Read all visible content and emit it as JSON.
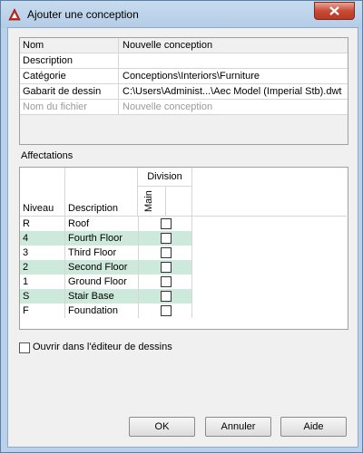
{
  "window": {
    "title": "Ajouter une conception",
    "icon": "autocad-logo-icon"
  },
  "properties": [
    {
      "key": "Nom",
      "value": "Nouvelle conception"
    },
    {
      "key": "Description",
      "value": ""
    },
    {
      "key": "Catégorie",
      "value": "Conceptions\\Interiors\\Furniture"
    },
    {
      "key": "Gabarit de dessin",
      "value": "C:\\Users\\Administ...\\Aec Model (Imperial Stb).dwt"
    },
    {
      "key": "Nom du fichier",
      "value": "Nouvelle conception"
    }
  ],
  "assignments": {
    "label": "Affectations",
    "headers": {
      "level": "Niveau",
      "description": "Description",
      "division": "Division",
      "main": "Main"
    },
    "rows": [
      {
        "level": "R",
        "description": "Roof",
        "checked": false
      },
      {
        "level": "4",
        "description": "Fourth Floor",
        "checked": false
      },
      {
        "level": "3",
        "description": "Third Floor",
        "checked": false
      },
      {
        "level": "2",
        "description": "Second Floor",
        "checked": false
      },
      {
        "level": "1",
        "description": "Ground Floor",
        "checked": false
      },
      {
        "level": "S",
        "description": "Stair Base",
        "checked": false
      },
      {
        "level": "F",
        "description": "Foundation",
        "checked": false
      }
    ]
  },
  "open_in_editor": {
    "label": "Ouvrir dans l'éditeur de dessins",
    "checked": false
  },
  "buttons": {
    "ok": "OK",
    "cancel": "Annuler",
    "help": "Aide"
  },
  "colors": {
    "alt_row": "#cde9dc",
    "title_bar": "#b9d1ea",
    "close": "#c94a35"
  }
}
